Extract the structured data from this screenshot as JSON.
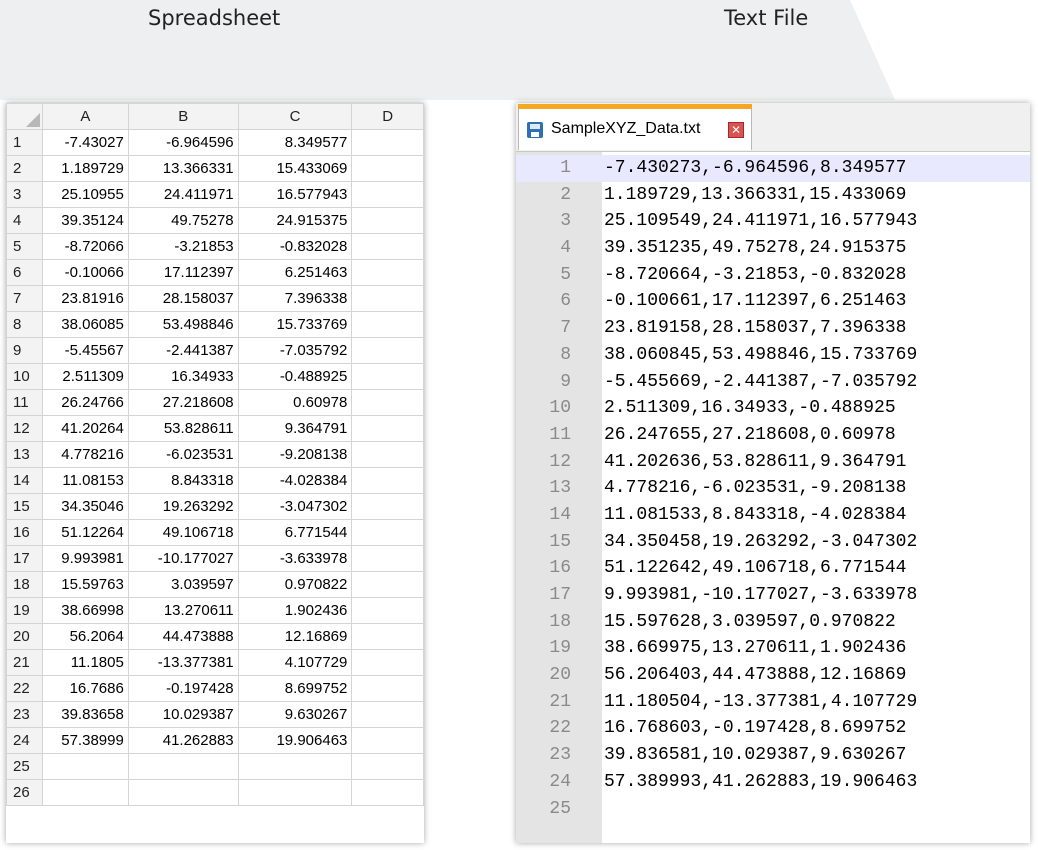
{
  "captions": {
    "left": "Spreadsheet",
    "right": "Text File"
  },
  "spreadsheet": {
    "columns": [
      "A",
      "B",
      "C",
      "D"
    ],
    "rows": [
      {
        "n": "1",
        "a": "-7.43027",
        "b": "-6.964596",
        "c": "8.349577"
      },
      {
        "n": "2",
        "a": "1.189729",
        "b": "13.366331",
        "c": "15.433069"
      },
      {
        "n": "3",
        "a": "25.10955",
        "b": "24.411971",
        "c": "16.577943"
      },
      {
        "n": "4",
        "a": "39.35124",
        "b": "49.75278",
        "c": "24.915375"
      },
      {
        "n": "5",
        "a": "-8.72066",
        "b": "-3.21853",
        "c": "-0.832028"
      },
      {
        "n": "6",
        "a": "-0.10066",
        "b": "17.112397",
        "c": "6.251463"
      },
      {
        "n": "7",
        "a": "23.81916",
        "b": "28.158037",
        "c": "7.396338"
      },
      {
        "n": "8",
        "a": "38.06085",
        "b": "53.498846",
        "c": "15.733769"
      },
      {
        "n": "9",
        "a": "-5.45567",
        "b": "-2.441387",
        "c": "-7.035792"
      },
      {
        "n": "10",
        "a": "2.511309",
        "b": "16.34933",
        "c": "-0.488925"
      },
      {
        "n": "11",
        "a": "26.24766",
        "b": "27.218608",
        "c": "0.60978"
      },
      {
        "n": "12",
        "a": "41.20264",
        "b": "53.828611",
        "c": "9.364791"
      },
      {
        "n": "13",
        "a": "4.778216",
        "b": "-6.023531",
        "c": "-9.208138"
      },
      {
        "n": "14",
        "a": "11.08153",
        "b": "8.843318",
        "c": "-4.028384"
      },
      {
        "n": "15",
        "a": "34.35046",
        "b": "19.263292",
        "c": "-3.047302"
      },
      {
        "n": "16",
        "a": "51.12264",
        "b": "49.106718",
        "c": "6.771544"
      },
      {
        "n": "17",
        "a": "9.993981",
        "b": "-10.177027",
        "c": "-3.633978"
      },
      {
        "n": "18",
        "a": "15.59763",
        "b": "3.039597",
        "c": "0.970822"
      },
      {
        "n": "19",
        "a": "38.66998",
        "b": "13.270611",
        "c": "1.902436"
      },
      {
        "n": "20",
        "a": "56.2064",
        "b": "44.473888",
        "c": "12.16869"
      },
      {
        "n": "21",
        "a": "11.1805",
        "b": "-13.377381",
        "c": "4.107729"
      },
      {
        "n": "22",
        "a": "16.7686",
        "b": "-0.197428",
        "c": "8.699752"
      },
      {
        "n": "23",
        "a": "39.83658",
        "b": "10.029387",
        "c": "9.630267"
      },
      {
        "n": "24",
        "a": "57.38999",
        "b": "41.262883",
        "c": "19.906463"
      },
      {
        "n": "25",
        "a": "",
        "b": "",
        "c": ""
      },
      {
        "n": "26",
        "a": "",
        "b": "",
        "c": ""
      }
    ]
  },
  "editor": {
    "tab_label": "SampleXYZ_Data.txt",
    "close_glyph": "✕",
    "current_line": 1,
    "lines": [
      "-7.430273,-6.964596,8.349577",
      "1.189729,13.366331,15.433069",
      "25.109549,24.411971,16.577943",
      "39.351235,49.75278,24.915375",
      "-8.720664,-3.21853,-0.832028",
      "-0.100661,17.112397,6.251463",
      "23.819158,28.158037,7.396338",
      "38.060845,53.498846,15.733769",
      "-5.455669,-2.441387,-7.035792",
      "2.511309,16.34933,-0.488925",
      "26.247655,27.218608,0.60978",
      "41.202636,53.828611,9.364791",
      "4.778216,-6.023531,-9.208138",
      "11.081533,8.843318,-4.028384",
      "34.350458,19.263292,-3.047302",
      "51.122642,49.106718,6.771544",
      "9.993981,-10.177027,-3.633978",
      "15.597628,3.039597,0.970822",
      "38.669975,13.270611,1.902436",
      "56.206403,44.473888,12.16869",
      "11.180504,-13.377381,4.107729",
      "16.768603,-0.197428,8.699752",
      "39.836581,10.029387,9.630267",
      "57.389993,41.262883,19.906463",
      ""
    ]
  }
}
